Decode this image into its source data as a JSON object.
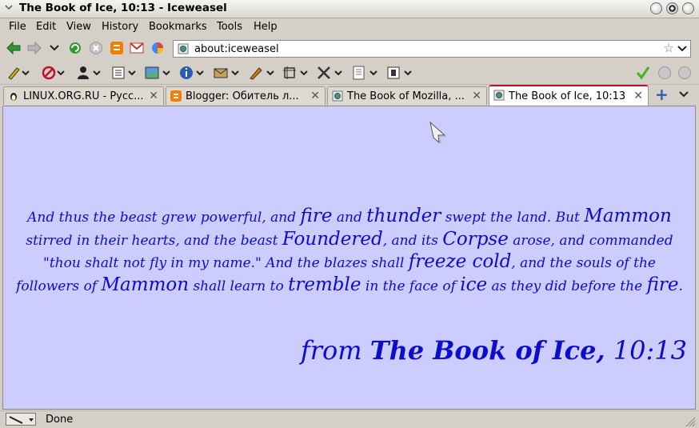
{
  "window": {
    "title": "The Book of Ice, 10:13 - Iceweasel"
  },
  "menu": {
    "items": [
      "File",
      "Edit",
      "View",
      "History",
      "Bookmarks",
      "Tools",
      "Help"
    ]
  },
  "navigation": {
    "url": "about:iceweasel"
  },
  "tabs": [
    {
      "label": "LINUX.ORG.RU - Русс...",
      "icon": "penguin-icon"
    },
    {
      "label": "Blogger: Обитель л...",
      "icon": "blogger-icon"
    },
    {
      "label": "The Book of Mozilla, ...",
      "icon": "page-icon"
    },
    {
      "label": "The Book of Ice, 10:13",
      "icon": "page-icon",
      "active": true
    }
  ],
  "content": {
    "passage": [
      {
        "t": "And thus the beast grew powerful, and "
      },
      {
        "t": "fire",
        "big": true
      },
      {
        "t": " and "
      },
      {
        "t": "thunder",
        "big": true
      },
      {
        "t": " swept the land. But "
      },
      {
        "t": "Mammon",
        "big": true
      },
      {
        "t": " stirred in their hearts, and the beast "
      },
      {
        "t": "Foundered",
        "big": true
      },
      {
        "t": ", and its "
      },
      {
        "t": "Corpse",
        "big": true
      },
      {
        "t": " arose, and commanded \"thou shalt not fly in my name.\" And the blazes shall "
      },
      {
        "t": "freeze cold",
        "big": true
      },
      {
        "t": ", and the souls of the followers of "
      },
      {
        "t": "Mammon",
        "big": true
      },
      {
        "t": " shall learn to "
      },
      {
        "t": "tremble",
        "big": true
      },
      {
        "t": " in the face of "
      },
      {
        "t": "ice",
        "big": true
      },
      {
        "t": " as they did before the "
      },
      {
        "t": "fire",
        "big": true
      },
      {
        "t": "."
      }
    ],
    "attribution": {
      "prefix": "from ",
      "book": "The Book of Ice,",
      "verse": " 10:13"
    },
    "background": "#ccccff",
    "text_color": "#0c0ccc"
  },
  "status": {
    "text": "Done"
  },
  "colors": {
    "active_tab_accent": "#c0102a",
    "chrome": "#d4d0c8"
  }
}
